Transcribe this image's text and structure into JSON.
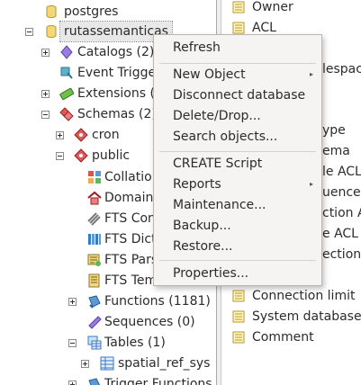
{
  "tree": {
    "items": [
      {
        "label": "postgres"
      },
      {
        "label": "rutassemanticas"
      },
      {
        "label": "Catalogs (2)"
      },
      {
        "label": "Event Trigge"
      },
      {
        "label": "Extensions ("
      },
      {
        "label": "Schemas (2)"
      },
      {
        "label": "cron"
      },
      {
        "label": "public"
      },
      {
        "label": "Collatio"
      },
      {
        "label": "Domain"
      },
      {
        "label": "FTS Con"
      },
      {
        "label": "FTS Dict"
      },
      {
        "label": "FTS Pars"
      },
      {
        "label": "FTS Tem"
      },
      {
        "label": "Functions (1181)"
      },
      {
        "label": "Sequences (0)"
      },
      {
        "label": "Tables (1)"
      },
      {
        "label": "spatial_ref_sys"
      },
      {
        "label": "Trigger Functions"
      }
    ]
  },
  "properties": {
    "items": [
      {
        "label": "Owner"
      },
      {
        "label": "ACL"
      },
      {
        "label": "lespac"
      },
      {
        "label": "ype"
      },
      {
        "label": "ema"
      },
      {
        "label": "le ACL"
      },
      {
        "label": "uence"
      },
      {
        "label": "ction A"
      },
      {
        "label": "e ACL"
      },
      {
        "label": "ections"
      },
      {
        "label": "Connection limit"
      },
      {
        "label": "System database?"
      },
      {
        "label": "Comment"
      }
    ]
  },
  "context_menu": {
    "items": [
      {
        "label": "Refresh"
      },
      {
        "label": "New Object",
        "submenu": true
      },
      {
        "label": "Disconnect database"
      },
      {
        "label": "Delete/Drop..."
      },
      {
        "label": "Search objects..."
      },
      {
        "label": "CREATE Script"
      },
      {
        "label": "Reports",
        "submenu": true
      },
      {
        "label": "Maintenance..."
      },
      {
        "label": "Backup..."
      },
      {
        "label": "Restore..."
      },
      {
        "label": "Properties..."
      }
    ],
    "submenu_arrow": "▸"
  },
  "colors": {
    "selection_bg": "#e8e8e8",
    "menu_bg": "#f5f4f3",
    "divider_bg": "#f0efee"
  }
}
